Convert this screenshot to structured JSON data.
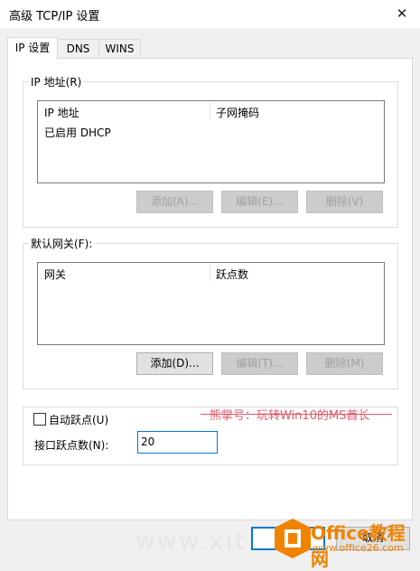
{
  "window": {
    "title": "高级 TCP/IP 设置",
    "close_symbol": "✕"
  },
  "tabs": [
    {
      "label": "IP 设置",
      "active": true
    },
    {
      "label": "DNS",
      "active": false
    },
    {
      "label": "WINS",
      "active": false
    }
  ],
  "ip_group": {
    "legend": "IP 地址(R)",
    "columns": [
      "IP 地址",
      "子网掩码"
    ],
    "rows": [
      "已启用 DHCP"
    ],
    "buttons": [
      {
        "label": "添加(A)...",
        "enabled": false
      },
      {
        "label": "编辑(E)...",
        "enabled": false
      },
      {
        "label": "删除(V)",
        "enabled": false
      }
    ]
  },
  "gateway_group": {
    "legend": "默认网关(F):",
    "columns": [
      "网关",
      "跃点数"
    ],
    "buttons": [
      {
        "label": "添加(D)...",
        "enabled": true
      },
      {
        "label": "编辑(T)...",
        "enabled": false
      },
      {
        "label": "删除(M)",
        "enabled": false
      }
    ]
  },
  "metric": {
    "auto_label": "自动跃点(U)",
    "auto_checked": false,
    "metric_label": "接口跃点数(N):",
    "metric_value": "20"
  },
  "overlay": {
    "watermark_text": "熊掌号：玩转Win10的MS酋长",
    "faint_text": "www.xit",
    "brand_name": "Office教程网",
    "brand_url": "www.office26.com",
    "partial_button": "取消",
    "brand_color": "#f08300",
    "watermark_color": "#e05a6a"
  }
}
